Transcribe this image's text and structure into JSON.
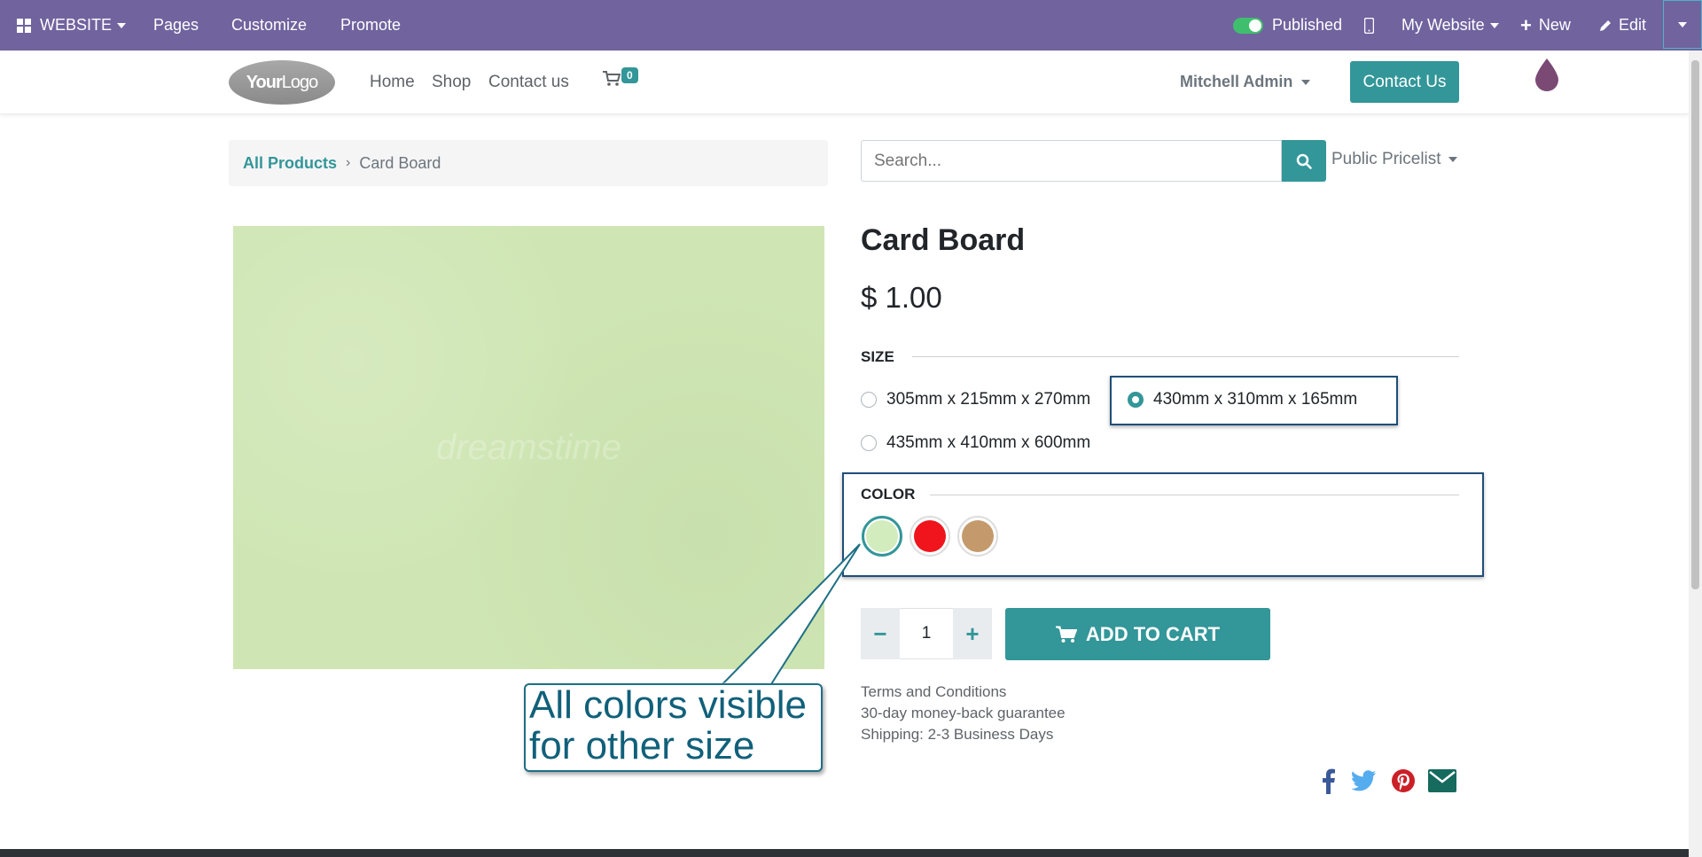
{
  "topbar": {
    "website_label": "WEBSITE",
    "pages_label": "Pages",
    "customize_label": "Customize",
    "promote_label": "Promote",
    "published_label": "Published",
    "website_selector": "My Website",
    "new_label": "New",
    "edit_label": "Edit"
  },
  "navbar": {
    "logo_text_1": "Your",
    "logo_text_2": "Logo",
    "home": "Home",
    "shop": "Shop",
    "contact": "Contact us",
    "cart_count": "0",
    "user": "Mitchell Admin",
    "contact_button": "Contact Us"
  },
  "breadcrumb": {
    "root": "All Products",
    "current": "Card Board"
  },
  "search": {
    "placeholder": "Search...",
    "pricelist": "Public Pricelist"
  },
  "product": {
    "name": "Card Board",
    "price": "$ 1.00",
    "size_label": "SIZE",
    "sizes": [
      {
        "label": "305mm x 215mm x 270mm",
        "selected": false
      },
      {
        "label": "430mm x 310mm x 165mm",
        "selected": true
      },
      {
        "label": "435mm x 410mm x 600mm",
        "selected": false
      }
    ],
    "color_label": "COLOR",
    "colors": [
      {
        "name": "light-green",
        "hex": "#d3ecbd",
        "selected": true
      },
      {
        "name": "red",
        "hex": "#f0141c",
        "selected": false
      },
      {
        "name": "brown",
        "hex": "#c49a6c",
        "selected": false
      }
    ],
    "quantity": "1",
    "add_to_cart": "ADD TO CART",
    "terms": "Terms and Conditions",
    "guarantee": "30-day money-back guarantee",
    "shipping": "Shipping: 2-3 Business Days",
    "image_watermark": "dreamstime"
  },
  "callout": {
    "line1": "All colors visible",
    "line2": "for other size"
  },
  "colors": {
    "topbar": "#71639e",
    "accent": "#339699",
    "highlight_border": "#1f4e79"
  }
}
